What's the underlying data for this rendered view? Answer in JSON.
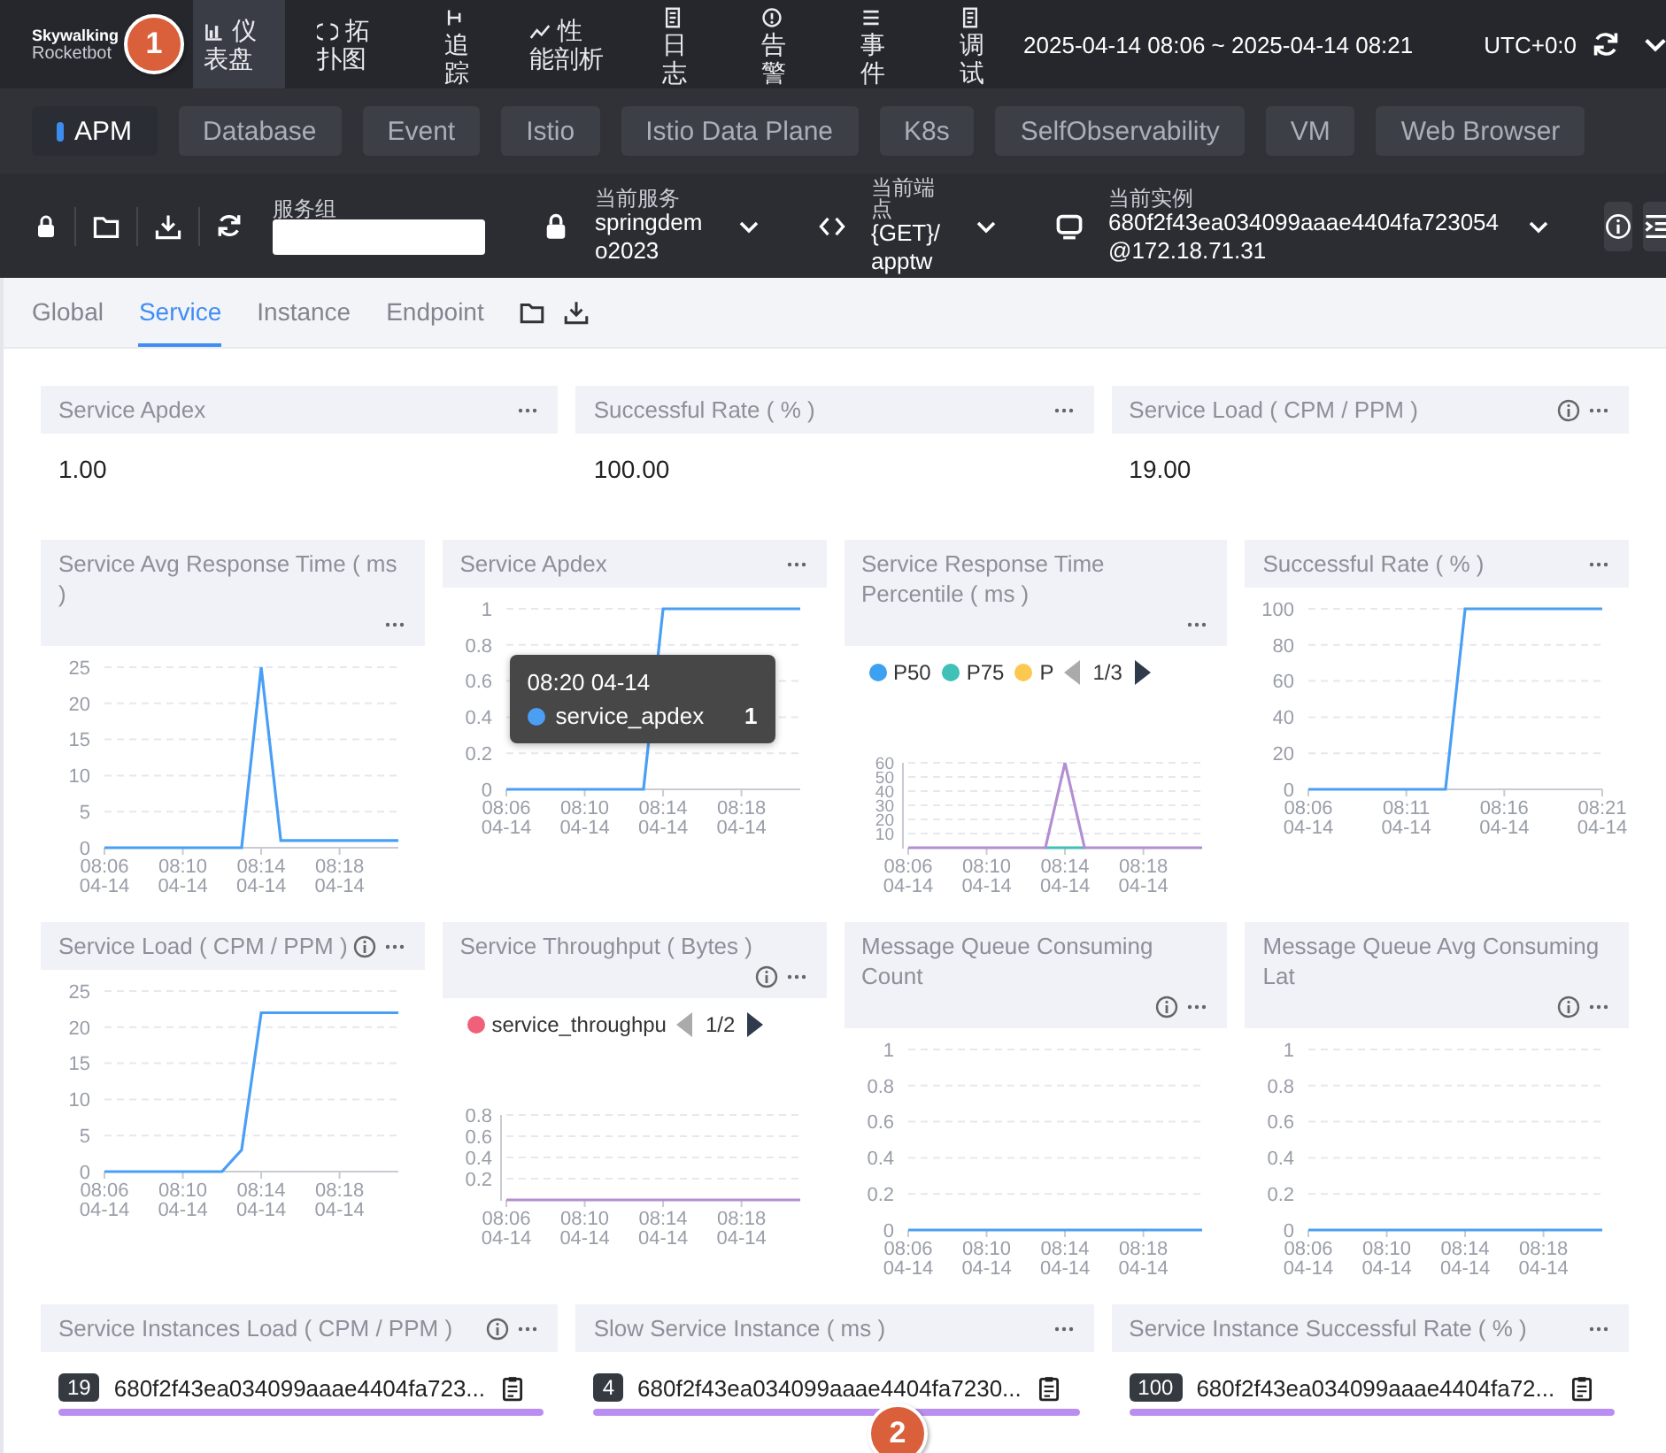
{
  "header": {
    "logo_title": "Skywalking",
    "logo_subtitle": "Rocketbot",
    "nav": [
      {
        "label": "仪表盘",
        "kind": "chart",
        "selected": true
      },
      {
        "label": "拓扑图",
        "kind": "topology",
        "selected": false
      },
      {
        "label": "追踪",
        "kind": "trace",
        "selected": false
      },
      {
        "label": "性能剖析",
        "kind": "profile",
        "selected": false
      },
      {
        "label": "日志",
        "kind": "log",
        "selected": false
      },
      {
        "label": "告警",
        "kind": "alarm",
        "selected": false
      },
      {
        "label": "事件",
        "kind": "event",
        "selected": false
      },
      {
        "label": "调试",
        "kind": "log",
        "selected": false
      }
    ],
    "time_range": "2025-04-14 08:06 ~ 2025-04-14 08:21",
    "timezone": "UTC+0:0"
  },
  "layers": [
    {
      "label": "APM",
      "selected": true
    },
    {
      "label": "Database",
      "selected": false
    },
    {
      "label": "Event",
      "selected": false
    },
    {
      "label": "Istio",
      "selected": false
    },
    {
      "label": "Istio Data Plane",
      "selected": false
    },
    {
      "label": "K8s",
      "selected": false
    },
    {
      "label": "SelfObservability",
      "selected": false
    },
    {
      "label": "VM",
      "selected": false
    },
    {
      "label": "Web Browser",
      "selected": false
    }
  ],
  "selectors": {
    "service_group": {
      "label": "服务组"
    },
    "service": {
      "label": "当前服务",
      "value": "springdemo2023"
    },
    "endpoint": {
      "label": "当前端点",
      "value": "{GET}/apptw"
    },
    "instance": {
      "label": "当前实例",
      "value": "680f2f43ea034099aaae4404fa723054@172.18.71.31"
    }
  },
  "tabs": [
    {
      "label": "Global",
      "selected": false
    },
    {
      "label": "Service",
      "selected": true
    },
    {
      "label": "Instance",
      "selected": false
    },
    {
      "label": "Endpoint",
      "selected": false
    }
  ],
  "rows": [
    {
      "cards": [
        {
          "kind": "value",
          "title": "Service Apdex",
          "info": false,
          "value": "1.00"
        },
        {
          "kind": "value",
          "title": "Successful Rate ( % )",
          "info": false,
          "value": "100.00"
        },
        {
          "kind": "value",
          "title": "Service Load ( CPM / PPM )",
          "info": true,
          "value": "19.00"
        }
      ]
    },
    {
      "cards": [
        {
          "kind": "chart",
          "title": "Service Avg Response Time ( ms )",
          "info": false,
          "chart_data": {
            "type": "line",
            "grid": true,
            "categories": [
              "08:06 04-14",
              null,
              null,
              null,
              "08:10 04-14",
              null,
              null,
              null,
              "08:14 04-14",
              null,
              null,
              null,
              "08:18 04-14",
              null,
              null,
              null
            ],
            "ylim": [
              0,
              25
            ],
            "yticks": [
              0,
              5,
              10,
              15,
              20,
              25
            ],
            "series": [
              {
                "color": "#4a9ff5",
                "values": [
                  0,
                  0,
                  0,
                  0,
                  0,
                  0,
                  0,
                  0,
                  25,
                  1,
                  1,
                  1,
                  1,
                  1,
                  1,
                  1
                ]
              }
            ]
          }
        },
        {
          "kind": "chart",
          "title": "Service Apdex",
          "info": false,
          "tooltip": {
            "title": "08:20 04-14",
            "series": "service_apdex",
            "value": "1",
            "color": "#4a9ff5"
          },
          "chart_data": {
            "type": "line",
            "grid": true,
            "categories": [
              "08:06 04-14",
              null,
              null,
              null,
              "08:10 04-14",
              null,
              null,
              null,
              "08:14 04-14",
              null,
              null,
              null,
              "08:18 04-14",
              null,
              null,
              null
            ],
            "ylim": [
              0,
              1
            ],
            "yticks": [
              0,
              0.2,
              0.4,
              0.6,
              0.8,
              1
            ],
            "series": [
              {
                "color": "#4a9ff5",
                "values": [
                  0,
                  0,
                  0,
                  0,
                  0,
                  0,
                  0,
                  0,
                  1,
                  1,
                  1,
                  1,
                  1,
                  1,
                  1,
                  1
                ]
              }
            ]
          }
        },
        {
          "kind": "chart",
          "title": "Service Response Time Percentile ( ms )",
          "info": false,
          "legend_page": "1/3",
          "chart_data": {
            "type": "line",
            "grid": true,
            "legend": "top",
            "categories": [
              "08:06 04-14",
              null,
              null,
              null,
              "08:10 04-14",
              null,
              null,
              null,
              "08:14 04-14",
              null,
              null,
              null,
              "08:18 04-14",
              null,
              null,
              null
            ],
            "ylim": [
              0,
              60
            ],
            "yticks": [
              10,
              20,
              30,
              40,
              50,
              60
            ],
            "series": [
              {
                "name": "P50",
                "color": "#3ba1f0",
                "values": [
                  null,
                  null,
                  null,
                  null,
                  null,
                  null,
                  null,
                  null,
                  null,
                  null,
                  null,
                  null,
                  null,
                  null,
                  null,
                  null
                ]
              },
              {
                "name": "P75",
                "color": "#3fc1b7",
                "values": [
                  null,
                  null,
                  null,
                  null,
                  null,
                  null,
                  null,
                  0,
                  0,
                  0,
                  null,
                  null,
                  null,
                  null,
                  null,
                  null
                ]
              },
              {
                "name": "P",
                "color": "#fbc94f",
                "values": [
                  null,
                  null,
                  null,
                  null,
                  null,
                  null,
                  null,
                  null,
                  null,
                  null,
                  null,
                  null,
                  null,
                  null,
                  null,
                  null
                ]
              },
              {
                "color": "#b38ed3",
                "values": [
                  0,
                  0,
                  0,
                  0,
                  0,
                  0,
                  0,
                  0,
                  60,
                  0,
                  0,
                  0,
                  0,
                  0,
                  0,
                  0
                ]
              }
            ]
          }
        },
        {
          "kind": "chart",
          "title": "Successful Rate ( % )",
          "info": false,
          "chart_data": {
            "type": "line",
            "grid": true,
            "categories": [
              "08:06 04-14",
              null,
              null,
              null,
              null,
              "08:11 04-14",
              null,
              null,
              null,
              null,
              "08:16 04-14",
              null,
              null,
              null,
              null,
              "08:21 04-14"
            ],
            "ylim": [
              0,
              100
            ],
            "yticks": [
              0,
              20,
              40,
              60,
              80,
              100
            ],
            "series": [
              {
                "color": "#4a9ff5",
                "values": [
                  0,
                  0,
                  0,
                  0,
                  0,
                  0,
                  0,
                  0,
                  100,
                  100,
                  100,
                  100,
                  100,
                  100,
                  100,
                  100
                ]
              }
            ]
          }
        }
      ]
    },
    {
      "cards": [
        {
          "kind": "chart",
          "title": "Service Load ( CPM / PPM )",
          "info": true,
          "chart_data": {
            "type": "line",
            "grid": true,
            "categories": [
              "08:06 04-14",
              null,
              null,
              null,
              "08:10 04-14",
              null,
              null,
              null,
              "08:14 04-14",
              null,
              null,
              null,
              "08:18 04-14",
              null,
              null,
              null
            ],
            "ylim": [
              0,
              25
            ],
            "yticks": [
              0,
              5,
              10,
              15,
              20,
              25
            ],
            "series": [
              {
                "color": "#4a9ff5",
                "values": [
                  0,
                  0,
                  0,
                  0,
                  0,
                  0,
                  0,
                  3,
                  22,
                  22,
                  22,
                  22,
                  22,
                  22,
                  22,
                  22
                ]
              }
            ]
          }
        },
        {
          "kind": "chart",
          "title": "Service Throughput ( Bytes )",
          "info": true,
          "legend_page": "1/2",
          "chart_data": {
            "type": "line",
            "grid": true,
            "legend": "top",
            "categories": [
              "08:06 04-14",
              null,
              null,
              null,
              "08:10 04-14",
              null,
              null,
              null,
              "08:14 04-14",
              null,
              null,
              null,
              "08:18 04-14",
              null,
              null,
              null
            ],
            "ylim": [
              0,
              0.8
            ],
            "yticks": [
              0.2,
              0.4,
              0.6,
              0.8
            ],
            "series": [
              {
                "name": "service_throughpu",
                "color": "#f0607a",
                "values": [
                  null,
                  null,
                  null,
                  null,
                  null,
                  null,
                  null,
                  null,
                  null,
                  null,
                  null,
                  null,
                  null,
                  null,
                  null,
                  null
                ]
              },
              {
                "color": "#b38ed3",
                "values": [
                  0,
                  0,
                  0,
                  0,
                  0,
                  0,
                  0,
                  0,
                  0,
                  0,
                  0,
                  0,
                  0,
                  0,
                  0,
                  0
                ]
              }
            ]
          }
        },
        {
          "kind": "chart",
          "title": "Message Queue Consuming Count",
          "info": true,
          "chart_data": {
            "type": "line",
            "grid": true,
            "categories": [
              "08:06 04-14",
              null,
              null,
              null,
              "08:10 04-14",
              null,
              null,
              null,
              "08:14 04-14",
              null,
              null,
              null,
              "08:18 04-14",
              null,
              null,
              null
            ],
            "ylim": [
              0,
              1
            ],
            "yticks": [
              0,
              0.2,
              0.4,
              0.6,
              0.8,
              1
            ],
            "series": [
              {
                "color": "#4a9ff5",
                "values": [
                  0,
                  0,
                  0,
                  0,
                  0,
                  0,
                  0,
                  0,
                  0,
                  0,
                  0,
                  0,
                  0,
                  0,
                  0,
                  0
                ]
              }
            ]
          }
        },
        {
          "kind": "chart",
          "title": "Message Queue Avg Consuming Lat",
          "info": true,
          "chart_data": {
            "type": "line",
            "grid": true,
            "categories": [
              "08:06 04-14",
              null,
              null,
              null,
              "08:10 04-14",
              null,
              null,
              null,
              "08:14 04-14",
              null,
              null,
              null,
              "08:18 04-14",
              null,
              null,
              null
            ],
            "ylim": [
              0,
              1
            ],
            "yticks": [
              0,
              0.2,
              0.4,
              0.6,
              0.8,
              1
            ],
            "series": [
              {
                "color": "#4a9ff5",
                "values": [
                  0,
                  0,
                  0,
                  0,
                  0,
                  0,
                  0,
                  0,
                  0,
                  0,
                  0,
                  0,
                  0,
                  0,
                  0,
                  0
                ]
              }
            ]
          }
        }
      ]
    },
    {
      "cards": [
        {
          "kind": "list",
          "title": "Service Instances Load ( CPM / PPM )",
          "info": true,
          "items": [
            {
              "value": "19",
              "name": "680f2f43ea034099aaae4404fa723...",
              "level": 1
            }
          ]
        },
        {
          "kind": "list",
          "title": "Slow Service Instance ( ms )",
          "info": false,
          "items": [
            {
              "value": "4",
              "name": "680f2f43ea034099aaae4404fa7230...",
              "level": 1
            }
          ]
        },
        {
          "kind": "list",
          "title": "Service Instance Successful Rate ( % )",
          "info": false,
          "items": [
            {
              "value": "100",
              "name": "680f2f43ea034099aaae4404fa72...",
              "level": 1
            }
          ]
        }
      ]
    }
  ],
  "callouts": [
    {
      "label": "1"
    },
    {
      "label": "2"
    }
  ]
}
